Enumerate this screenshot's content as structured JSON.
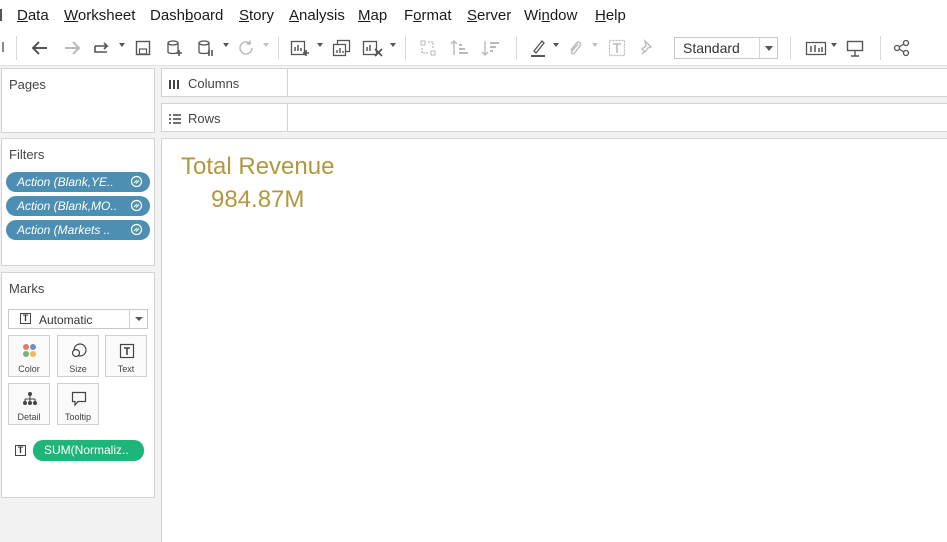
{
  "menu": {
    "items": [
      {
        "label": "Data",
        "ul": "D",
        "rest": "ata"
      },
      {
        "label": "Worksheet",
        "ul": "W",
        "rest": "orksheet"
      },
      {
        "label": "Dashboard",
        "pre": "Dash",
        "ul": "b",
        "rest": "oard"
      },
      {
        "label": "Story",
        "ul": "S",
        "rest": "tory"
      },
      {
        "label": "Analysis",
        "ul": "A",
        "rest": "nalysis"
      },
      {
        "label": "Map",
        "ul": "M",
        "rest": "ap"
      },
      {
        "label": "Format",
        "pre": "F",
        "ul": "o",
        "rest": "rmat"
      },
      {
        "label": "Server",
        "ul": "S",
        "rest": "erver"
      },
      {
        "label": "Window",
        "pre": "Wi",
        "ul": "n",
        "rest": "dow"
      },
      {
        "label": "Help",
        "ul": "H",
        "rest": "elp"
      }
    ]
  },
  "toolbar": {
    "fit_value": "Standard"
  },
  "pages": {
    "title": "Pages"
  },
  "filters": {
    "title": "Filters",
    "items": [
      {
        "label": "Action (Blank,YE.."
      },
      {
        "label": "Action (Blank,MO.."
      },
      {
        "label": "Action (Markets .."
      }
    ]
  },
  "marks": {
    "title": "Marks",
    "type": "Automatic",
    "buttons": {
      "color": "Color",
      "size": "Size",
      "text": "Text",
      "detail": "Detail",
      "tooltip": "Tooltip"
    },
    "field": "SUM(Normaliz.."
  },
  "shelves": {
    "columns": "Columns",
    "rows": "Rows"
  },
  "view": {
    "title": "Total Revenue",
    "value": "984.87M"
  },
  "colors": {
    "filter_pill": "#4d8fb3",
    "measure_pill": "#1db57a",
    "kpi_text": "#b2973c"
  }
}
